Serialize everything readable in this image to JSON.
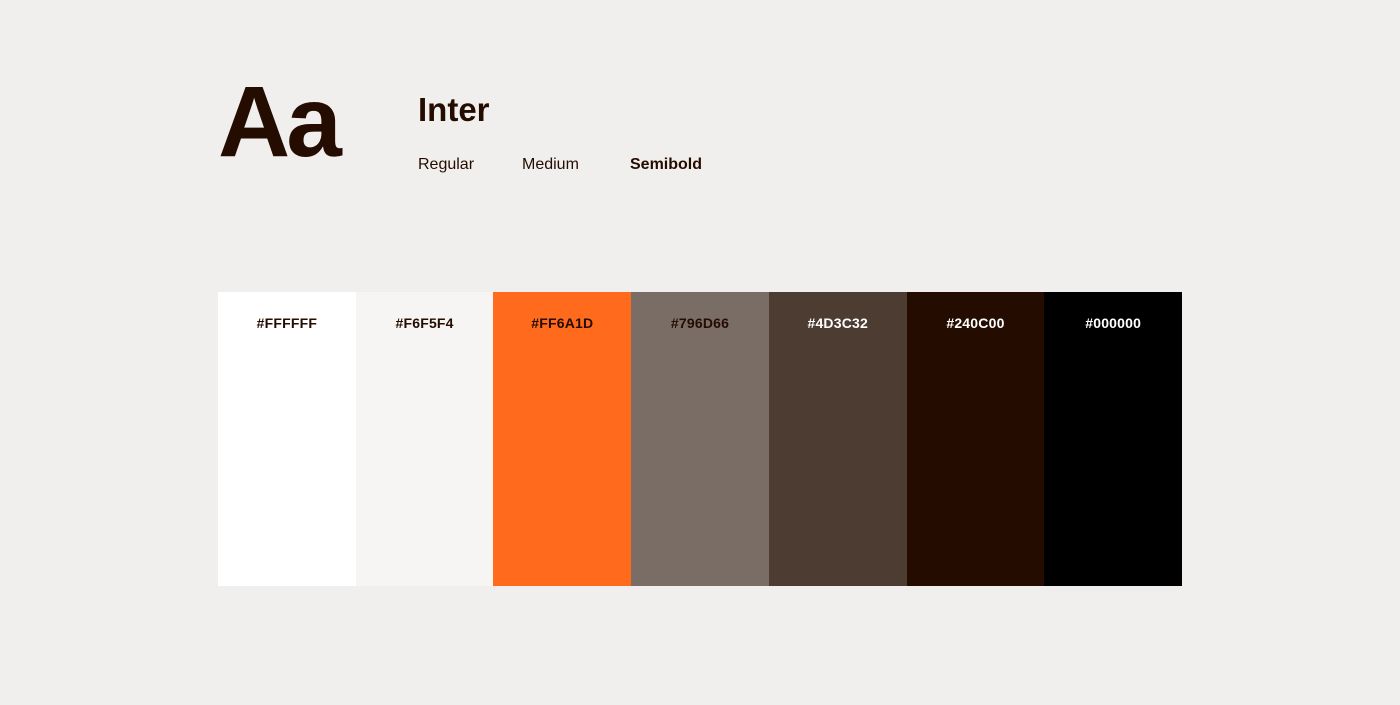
{
  "typography": {
    "specimen": "Aa",
    "font_name": "Inter",
    "weights": [
      "Regular",
      "Medium",
      "Semibold"
    ]
  },
  "palette": [
    {
      "hex": "#FFFFFF",
      "text_color": "#240C00"
    },
    {
      "hex": "#F6F5F4",
      "text_color": "#240C00"
    },
    {
      "hex": "#FF6A1D",
      "text_color": "#240C00"
    },
    {
      "hex": "#796D66",
      "text_color": "#240C00"
    },
    {
      "hex": "#4D3C32",
      "text_color": "#FFFFFF"
    },
    {
      "hex": "#240C00",
      "text_color": "#FFFFFF"
    },
    {
      "hex": "#000000",
      "text_color": "#FFFFFF"
    }
  ]
}
